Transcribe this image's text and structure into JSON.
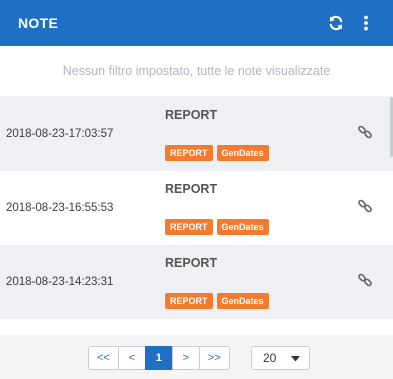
{
  "header": {
    "title": "NOTE",
    "refresh_icon": "refresh-icon",
    "menu_icon": "more-vertical-icon"
  },
  "filter": {
    "message": "Nessun filtro impostato, tutte le note visualizzate"
  },
  "notes": [
    {
      "date": "2018-08-23-17:03:57",
      "title": "REPORT",
      "tags": [
        "REPORT",
        "GenDates"
      ]
    },
    {
      "date": "2018-08-23-16:55:53",
      "title": "REPORT",
      "tags": [
        "REPORT",
        "GenDates"
      ]
    },
    {
      "date": "2018-08-23-14:23:31",
      "title": "REPORT",
      "tags": [
        "REPORT",
        "GenDates"
      ]
    }
  ],
  "pager": {
    "first": "<<",
    "prev": "<",
    "current": "1",
    "next": ">",
    "last": ">>",
    "page_size": "20"
  },
  "colors": {
    "primary": "#1f6fc5",
    "tag": "#f47a2e"
  }
}
